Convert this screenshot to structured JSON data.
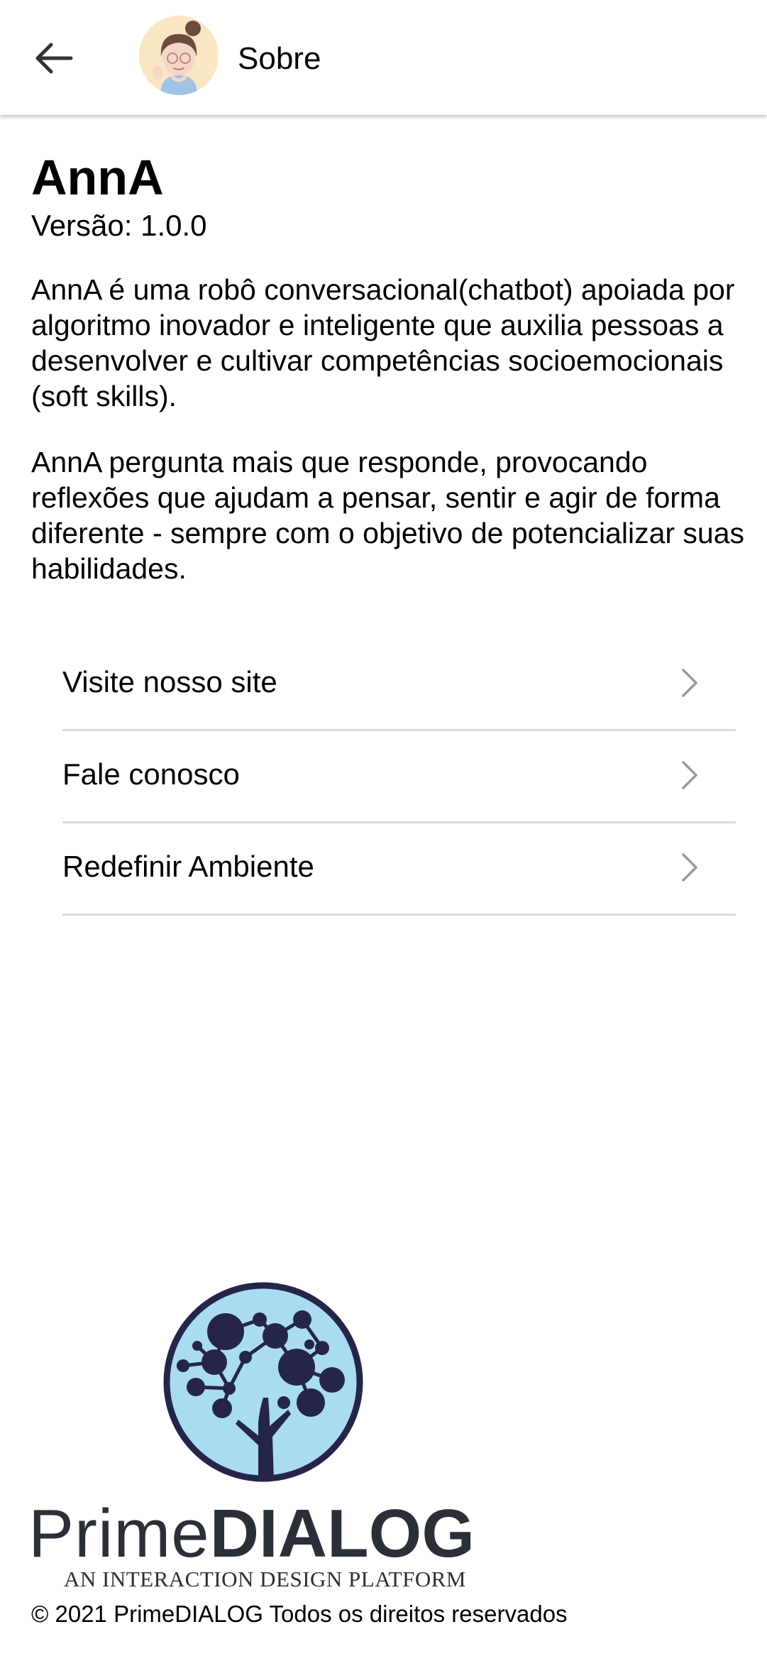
{
  "header": {
    "back_icon": "arrow-left-icon",
    "title": "Sobre"
  },
  "about": {
    "app_name": "AnnA",
    "version": "Versão: 1.0.0",
    "paragraphs": [
      "AnnA é uma robô conversacional(chatbot) apoiada por algoritmo inovador e inteligente que auxilia pessoas a desenvolver e cultivar competências socioemocionais (soft skills).",
      "AnnA pergunta mais que responde, provocando reflexões que ajudam a pensar, sentir e agir de forma diferente - sempre com o objetivo de potencializar suas habilidades."
    ]
  },
  "menu": {
    "items": [
      {
        "label": "Visite nosso site",
        "icon": "chevron-right-icon"
      },
      {
        "label": "Fale conosco",
        "icon": "chevron-right-icon"
      },
      {
        "label": "Redefinir Ambiente",
        "icon": "chevron-right-icon"
      }
    ]
  },
  "footer": {
    "logo_light": "Prime",
    "logo_bold": "DIALOG",
    "tagline": "AN INTERACTION DESIGN PLATFORM",
    "copyright": "© 2021 PrimeDIALOG Todos os direitos reservados"
  },
  "colors": {
    "logo_navy": "#25254a",
    "logo_sky": "#a9dcf3",
    "divider": "#dcdcdc",
    "chevron": "#9a9a9a"
  }
}
